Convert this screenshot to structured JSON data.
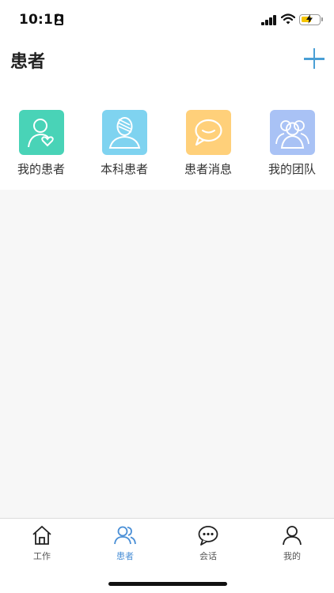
{
  "status_bar": {
    "time": "10:11",
    "icons": [
      "person-badge-icon",
      "cellular-signal-icon",
      "wifi-icon",
      "battery-charging-icon"
    ],
    "battery_color": "#f5c400"
  },
  "header": {
    "title": "患者",
    "add_icon": "plus-icon",
    "accent_color": "#4a9fd5"
  },
  "quick_links": [
    {
      "label": "我的患者",
      "icon": "user-heart-icon",
      "color": "#49d3b7"
    },
    {
      "label": "本科患者",
      "icon": "bandaged-patient-icon",
      "color": "#7fd3f0"
    },
    {
      "label": "患者消息",
      "icon": "chat-bubble-icon",
      "color": "#ffd07a"
    },
    {
      "label": "我的团队",
      "icon": "team-icon",
      "color": "#a9c2f5"
    }
  ],
  "tab_bar": {
    "active_tab": "患者",
    "active_color": "#4a8fd6",
    "tabs": [
      {
        "label": "工作",
        "icon": "home-icon"
      },
      {
        "label": "患者",
        "icon": "patients-icon"
      },
      {
        "label": "会话",
        "icon": "chat-icon"
      },
      {
        "label": "我的",
        "icon": "profile-icon"
      }
    ]
  }
}
